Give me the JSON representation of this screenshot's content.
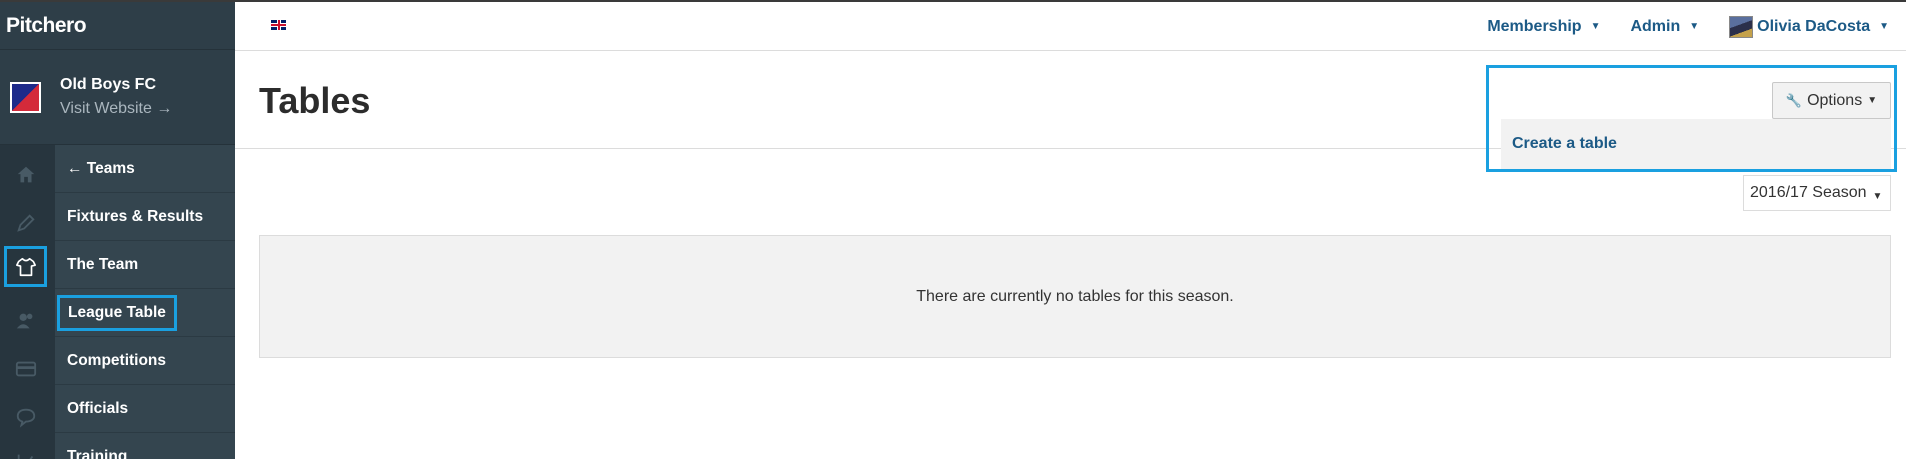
{
  "brand": {
    "logo_text": "Pitchero"
  },
  "club": {
    "name": "Old Boys FC",
    "visit_link": "Visit Website →"
  },
  "sidebar": {
    "icons": [
      "home-icon",
      "pen-icon",
      "shirt-icon",
      "people-icon",
      "card-icon",
      "chat-icon",
      "chart-icon"
    ],
    "items": [
      {
        "label": "← Teams"
      },
      {
        "label": "Fixtures & Results"
      },
      {
        "label": "The Team"
      },
      {
        "label": "League Table"
      },
      {
        "label": "Competitions"
      },
      {
        "label": "Officials"
      },
      {
        "label": "Training"
      }
    ]
  },
  "topbar": {
    "language_icon": "uk-flag-icon",
    "menu": [
      {
        "label": "Membership"
      },
      {
        "label": "Admin"
      },
      {
        "label": "Olivia DaCosta"
      }
    ]
  },
  "page": {
    "title": "Tables",
    "options_label": "Options",
    "dropdown_item": "Create a table",
    "season_select": "2016/17 Season",
    "empty_message": "There are currently no tables for this season."
  },
  "colors": {
    "sidebar": "#2e3e48",
    "accent_highlight": "#1aa0e0",
    "link": "#1c5a86"
  }
}
